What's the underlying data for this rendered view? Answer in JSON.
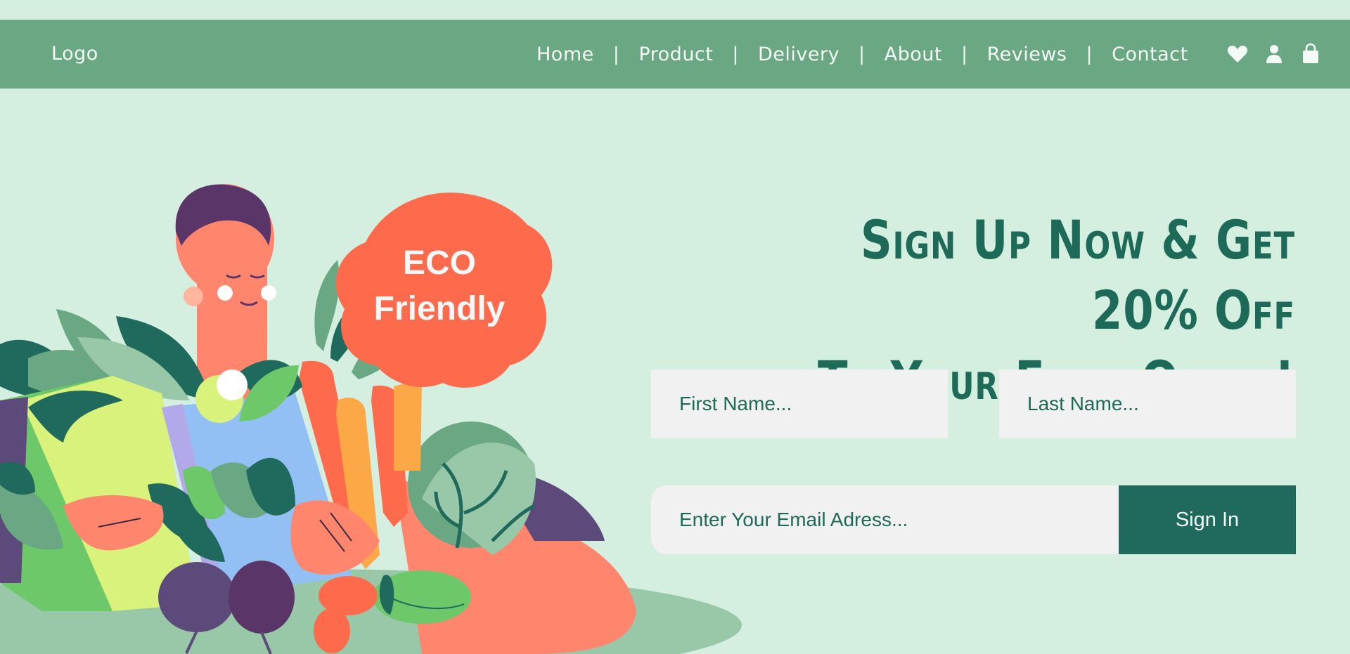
{
  "header": {
    "logo": "Logo",
    "nav": [
      "Home",
      "Product",
      "Delivery",
      "About",
      "Reviews",
      "Contact"
    ],
    "separator": "|",
    "icons": [
      "heart-icon",
      "user-icon",
      "shopping-bag-icon"
    ]
  },
  "badge": {
    "line1": "ECO",
    "line2": "Friendly"
  },
  "hero": {
    "headline_line1": "Sign Up Now & Get 20% Off",
    "headline_line2": "To Your First Order!"
  },
  "form": {
    "first_name_placeholder": "First Name...",
    "last_name_placeholder": "Last Name...",
    "email_placeholder": "Enter Your Email Adress...",
    "submit_label": "Sign In"
  },
  "colors": {
    "background": "#d4eedf",
    "navbar": "#69a882",
    "accent": "#1f6a5c",
    "badge": "#fe6a4c"
  }
}
